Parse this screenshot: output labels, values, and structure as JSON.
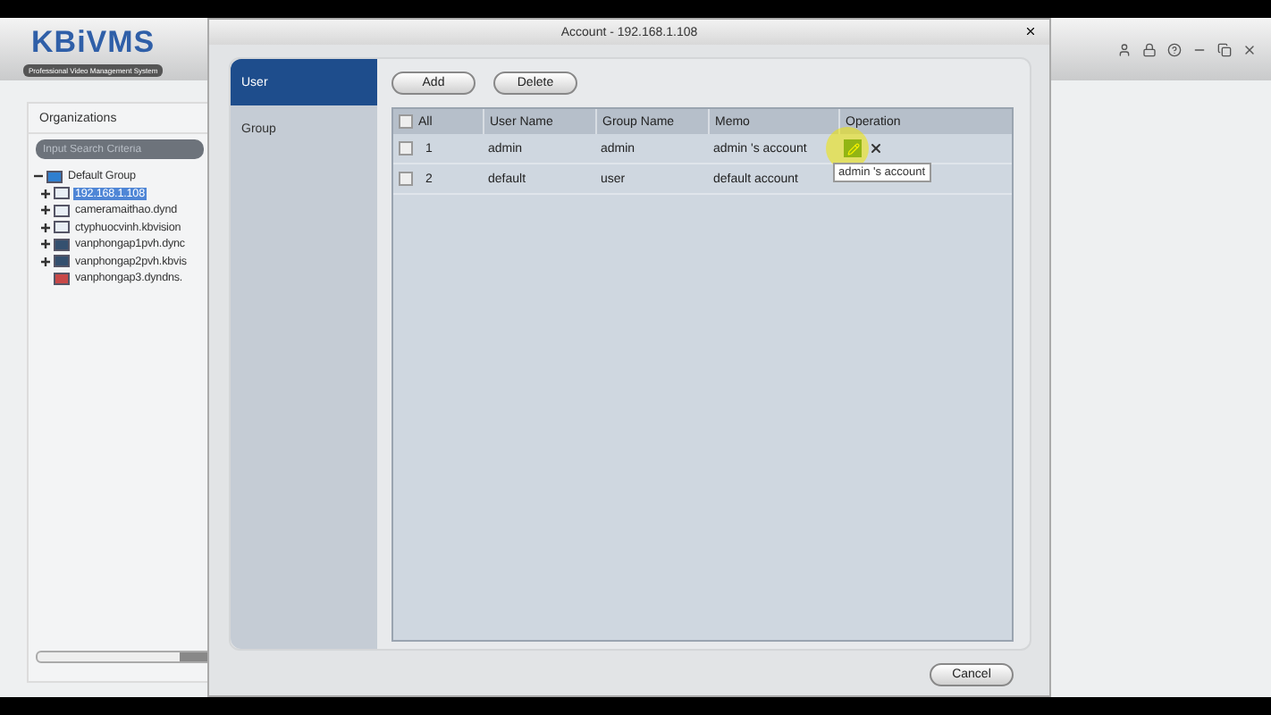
{
  "app": {
    "logo": "KBiVMS",
    "tagline": "Professional Video Management System"
  },
  "organizations": {
    "title": "Organizations",
    "search": {
      "placeholder": "Input Search Criteria"
    },
    "tree": [
      {
        "label": "Default Group",
        "kind": "group",
        "expanded": true,
        "selected": false,
        "children": [
          {
            "label": "192.168.1.108",
            "kind": "nvr",
            "expanded": false,
            "selected": true
          },
          {
            "label": "cameramaithao.dynd",
            "kind": "nvr",
            "expanded": false,
            "selected": false
          },
          {
            "label": "ctyphuocvinh.kbvision",
            "kind": "nvr",
            "expanded": false,
            "selected": false
          },
          {
            "label": "vanphongap1pvh.dync",
            "kind": "dvr",
            "expanded": false,
            "selected": false
          },
          {
            "label": "vanphongap2pvh.kbvis",
            "kind": "dvr",
            "expanded": false,
            "selected": false
          },
          {
            "label": "vanphongap3.dyndns.",
            "kind": "camera",
            "selected": false
          }
        ]
      }
    ]
  },
  "dialog": {
    "title": "Account - 192.168.1.108",
    "tabs": [
      {
        "label": "User",
        "selected": true
      },
      {
        "label": "Group",
        "selected": false
      }
    ],
    "buttons": [
      "Add",
      "Delete"
    ],
    "table": {
      "columns": [
        "All",
        "User Name",
        "Group Name",
        "Memo",
        "Operation"
      ],
      "all_checked": false,
      "rows": [
        {
          "no": "1",
          "user": "admin",
          "group": "admin",
          "memo": "admin 's account",
          "checked": false,
          "actions": true
        },
        {
          "no": "2",
          "user": "default",
          "group": "user",
          "memo": "default account",
          "checked": false,
          "actions": false
        }
      ]
    },
    "tooltip": "admin 's account",
    "cancel": "Cancel"
  }
}
